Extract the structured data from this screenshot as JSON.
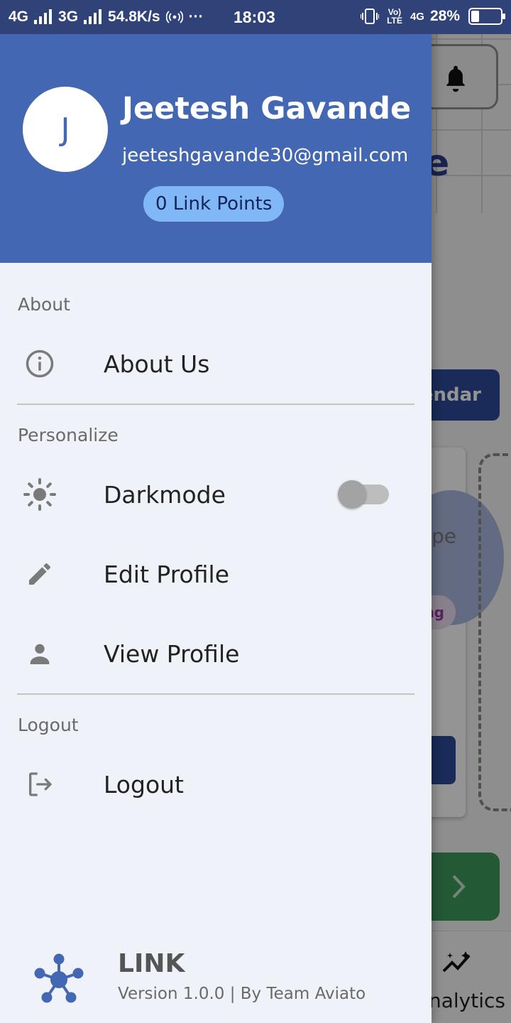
{
  "status_bar": {
    "network_1": "4G",
    "network_2": "3G",
    "speed": "54.8K/s",
    "more": "···",
    "time": "18:03",
    "volte": "Vo) LTE",
    "network_right": "4G",
    "battery_percent": "28%",
    "battery_level": 0.28
  },
  "background_app": {
    "heading_fragment": "e",
    "calendar_button_fragment": "endar",
    "card_text_fragment": "pe",
    "tag_fragment": "ng",
    "nav_label_fragment": "nalytics"
  },
  "drawer": {
    "header": {
      "avatar_initial": "J",
      "name": "Jeetesh Gavande",
      "email": "jeeteshgavande30@gmail.com",
      "points": "0 Link Points"
    },
    "sections": {
      "about": {
        "label": "About",
        "items": [
          {
            "label": "About Us",
            "icon": "info-icon"
          }
        ]
      },
      "personalize": {
        "label": "Personalize",
        "items": [
          {
            "label": "Darkmode",
            "icon": "sun-icon",
            "toggle": false
          },
          {
            "label": "Edit Profile",
            "icon": "pencil-icon"
          },
          {
            "label": "View Profile",
            "icon": "person-icon"
          }
        ]
      },
      "logout": {
        "label": "Logout",
        "items": [
          {
            "label": "Logout",
            "icon": "logout-icon"
          }
        ]
      }
    },
    "footer": {
      "app_name": "LINK",
      "version": "Version 1.0.0 | By Team Aviato"
    }
  },
  "colors": {
    "header": "#4367b2",
    "status_bar": "#2f4379",
    "drawer_bg": "#eff2f9",
    "points_badge": "#7fb7f7",
    "logo": "#4367b2"
  }
}
